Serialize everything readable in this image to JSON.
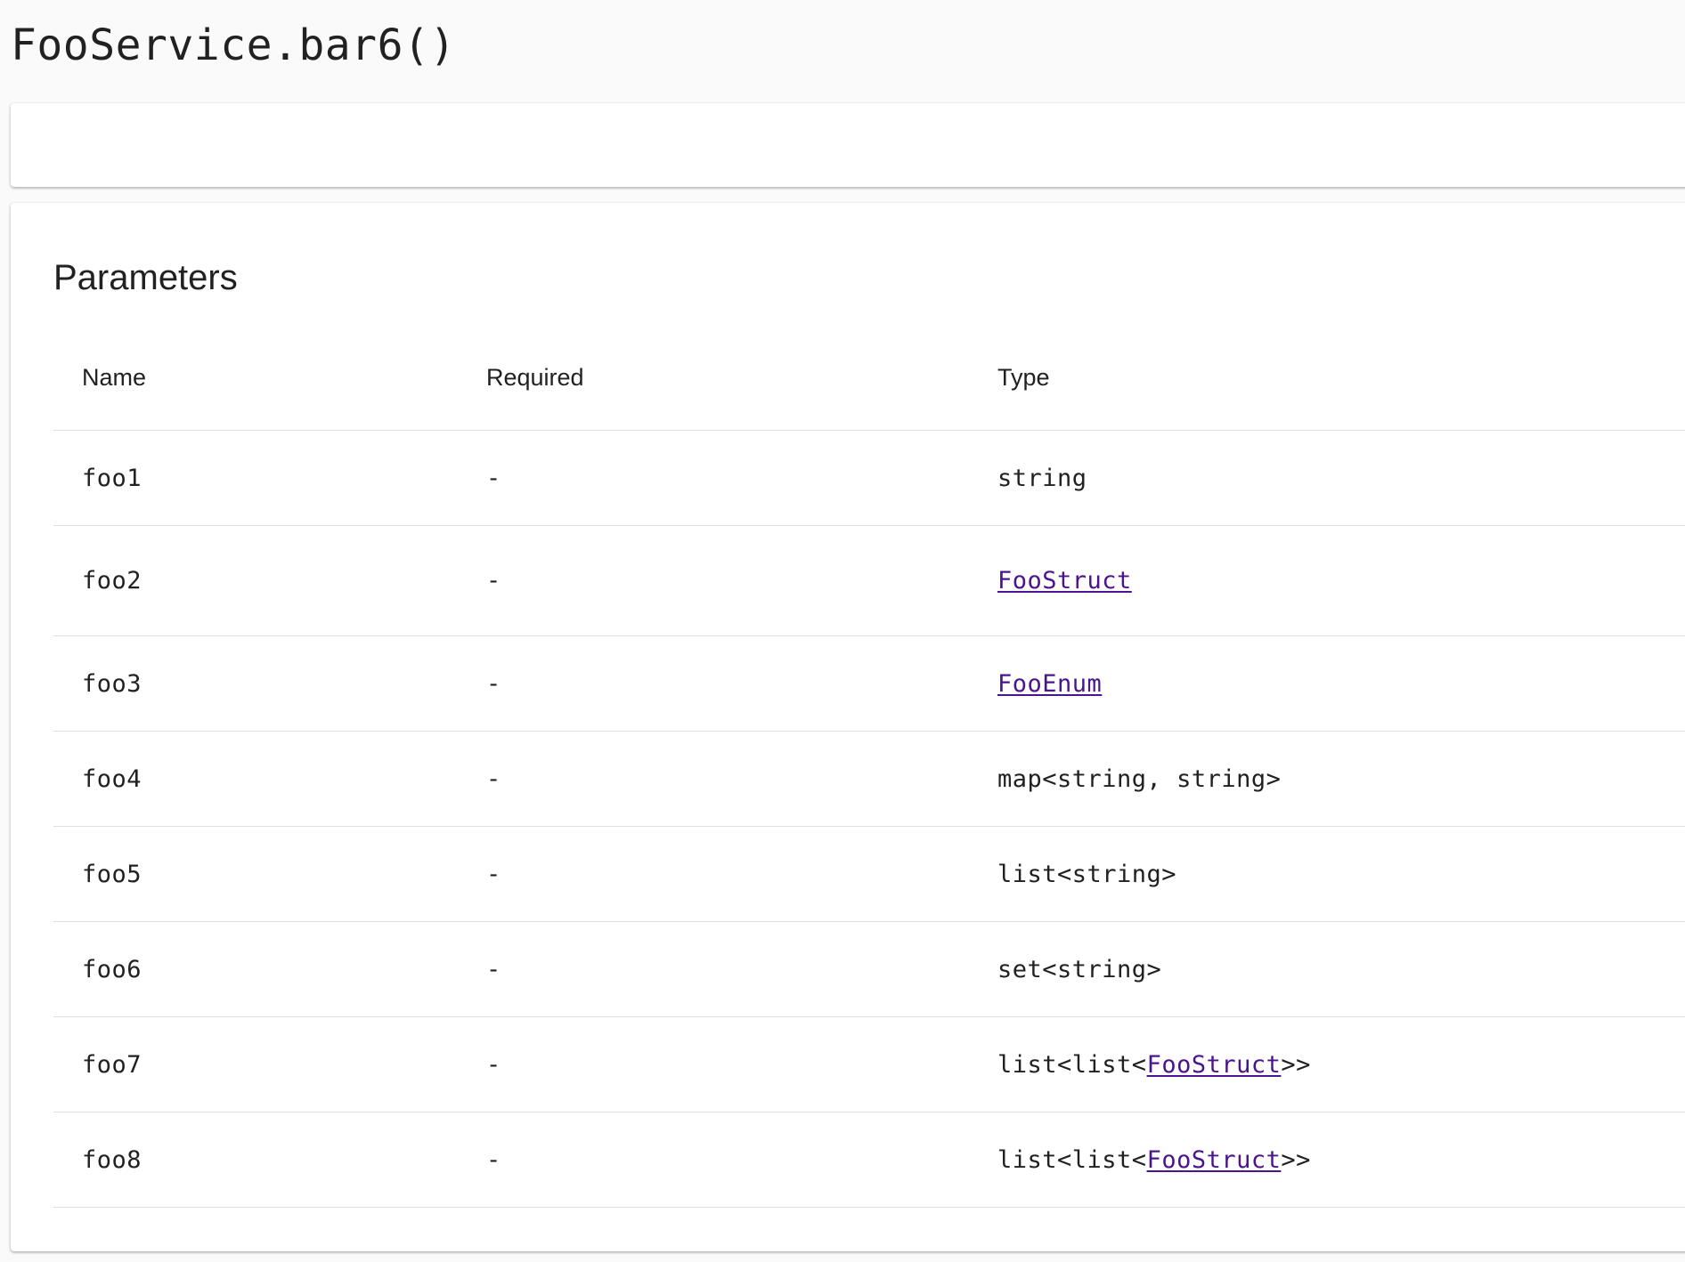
{
  "page": {
    "title": "FooService.bar6()"
  },
  "parameters": {
    "section_title": "Parameters",
    "columns": {
      "name": "Name",
      "required": "Required",
      "type": "Type"
    },
    "rows": [
      {
        "name": "foo1",
        "required": "-",
        "type_prefix": "string",
        "type_link": "",
        "type_suffix": ""
      },
      {
        "name": "foo2",
        "required": "-",
        "type_prefix": "",
        "type_link": "FooStruct",
        "type_suffix": ""
      },
      {
        "name": "foo3",
        "required": "-",
        "type_prefix": "",
        "type_link": "FooEnum",
        "type_suffix": ""
      },
      {
        "name": "foo4",
        "required": "-",
        "type_prefix": "map<string, string>",
        "type_link": "",
        "type_suffix": ""
      },
      {
        "name": "foo5",
        "required": "-",
        "type_prefix": "list<string>",
        "type_link": "",
        "type_suffix": ""
      },
      {
        "name": "foo6",
        "required": "-",
        "type_prefix": "set<string>",
        "type_link": "",
        "type_suffix": ""
      },
      {
        "name": "foo7",
        "required": "-",
        "type_prefix": "list<list<",
        "type_link": "FooStruct",
        "type_suffix": ">>"
      },
      {
        "name": "foo8",
        "required": "-",
        "type_prefix": "list<list<",
        "type_link": "FooStruct",
        "type_suffix": ">>"
      }
    ]
  },
  "colors": {
    "link": "#4a148c",
    "divider": "#e0e0e0",
    "background": "#fafafa"
  }
}
